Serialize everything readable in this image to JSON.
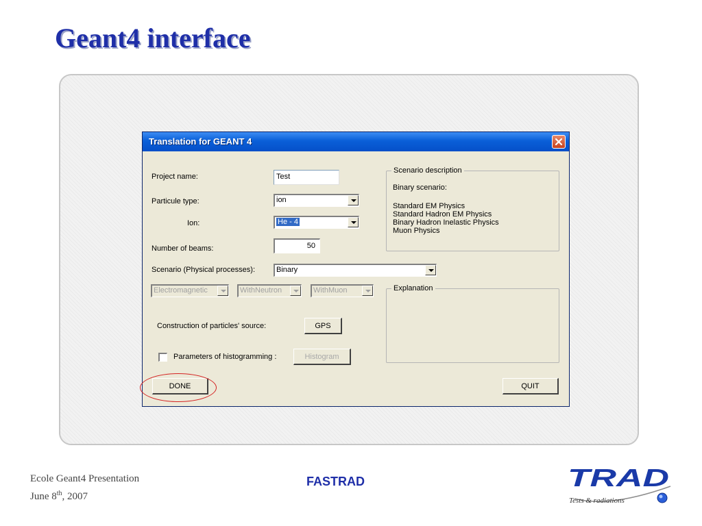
{
  "slide": {
    "title": "Geant4 interface"
  },
  "dialog": {
    "title": "Translation for GEANT 4",
    "labels": {
      "project_name": "Project name:",
      "particule_type": "Particule type:",
      "ion": "Ion:",
      "number_of_beams": "Number of beams:",
      "scenario": "Scenario (Physical processes):",
      "construction": "Construction of particles' source:",
      "parameters": "Parameters of histogramming :"
    },
    "project_name_value": "Test",
    "particule_type_value": "ion",
    "ion_value": "He - 4",
    "number_of_beams_value": "50",
    "scenario_value": "Binary",
    "options": {
      "electromagnetic": "Electromagnetic",
      "with_neutron": "WithNeutron",
      "with_muon": "WithMuon"
    },
    "scenario_description": {
      "group_title": "Scenario description",
      "heading": "Binary scenario:",
      "lines": [
        "Standard EM Physics",
        "Standard Hadron EM Physics",
        "Binary Hadron Inelastic Physics",
        "Muon Physics"
      ]
    },
    "explanation": {
      "group_title": "Explanation"
    },
    "buttons": {
      "gps": "GPS",
      "histogram": "Histogram",
      "done": "DONE",
      "quit": "QUIT"
    },
    "histogram_checked": false
  },
  "footer": {
    "line1": "Ecole Geant4 Presentation",
    "line2_prefix": "June 8",
    "line2_sup": "th",
    "line2_suffix": ", 2007",
    "center": "FASTRAD"
  },
  "logo": {
    "main": "TRAD",
    "tagline": "Tests & radiations"
  },
  "colors": {
    "title": "#1f2fa8",
    "titlebar": "#0a5fd8",
    "highlight": "#d42020",
    "dialog_bg": "#ece9d8"
  }
}
